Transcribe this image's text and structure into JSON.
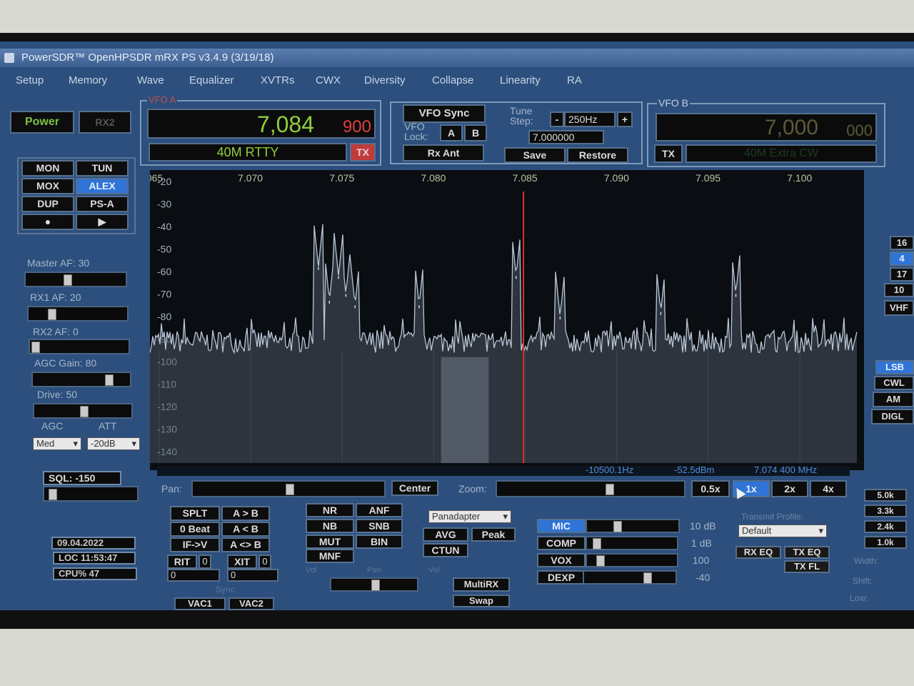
{
  "window": {
    "title": "PowerSDR™ OpenHPSDR mRX PS v3.4.9 (3/19/18)"
  },
  "menu": [
    "Setup",
    "Memory",
    "Wave",
    "Equalizer",
    "XVTRs",
    "CWX",
    "Diversity",
    "Collapse",
    "Linearity",
    "RA"
  ],
  "left": {
    "power": "Power",
    "rx2": "RX2",
    "grid": [
      "MON",
      "TUN",
      "MOX",
      "ALEX",
      "DUP",
      "PS-A",
      "●",
      "▶"
    ],
    "master_af": "Master AF:  30",
    "rx1_af": "RX1 AF:  20",
    "rx2_af": "RX2 AF:  0",
    "agc_gain": "AGC Gain:  80",
    "drive": "Drive:  50",
    "agc_label": "AGC",
    "att_label": "ATT",
    "agc_value": "Med",
    "att_value": "-20dB",
    "sql": "SQL: -150",
    "master_af_level": 0.4,
    "rx1_af_level": 0.2,
    "rx2_af_level": 0.0,
    "agc_gain_level": 0.8,
    "drive_level": 0.5
  },
  "vfo_a": {
    "label": "VFO A",
    "freq_main": "7,084",
    "freq_sub": "900",
    "band": "40M RTTY",
    "tx": "TX"
  },
  "center": {
    "vfo_sync": "VFO Sync",
    "vfo_lock": "VFO Lock:",
    "a": "A",
    "b": "B",
    "tune_step_label": "Tune Step:",
    "minus": "-",
    "step": "250Hz",
    "plus": "+",
    "rx_ant": "Rx Ant",
    "freq_field": "7.000000",
    "save": "Save",
    "restore": "Restore"
  },
  "vfo_b": {
    "label": "VFO B",
    "freq_main": "7,000",
    "freq_sub": "000",
    "tx": "TX",
    "band": "40M Extra CW"
  },
  "spectrum": {
    "freq_labels": [
      {
        "text": "065",
        "mhz": 7.065
      },
      {
        "text": "7.070",
        "mhz": 7.07
      },
      {
        "text": "7.075",
        "mhz": 7.075
      },
      {
        "text": "7.080",
        "mhz": 7.08
      },
      {
        "text": "7.085",
        "mhz": 7.085
      },
      {
        "text": "7.090",
        "mhz": 7.09
      },
      {
        "text": "7.095",
        "mhz": 7.095
      },
      {
        "text": "7.100",
        "mhz": 7.1
      }
    ],
    "db_labels": [
      "-20",
      "-30",
      "-40",
      "-50",
      "-60",
      "-70",
      "-80",
      "-90",
      "-100",
      "-110",
      "-120",
      "-130",
      "-140"
    ],
    "db_range": [
      -145,
      -15
    ],
    "freq_range": [
      7.0645,
      7.1035
    ],
    "vfo_mhz": 7.0849,
    "filter_mhz": [
      7.0804,
      7.083
    ],
    "noise_floor_db": -91,
    "peaks": [
      {
        "mhz": 7.0737,
        "db": -58
      },
      {
        "mhz": 7.0743,
        "db": -73
      },
      {
        "mhz": 7.0748,
        "db": -62
      },
      {
        "mhz": 7.0752,
        "db": -70
      },
      {
        "mhz": 7.0757,
        "db": -75
      },
      {
        "mhz": 7.0792,
        "db": -75
      },
      {
        "mhz": 7.0845,
        "db": -62
      },
      {
        "mhz": 7.0869,
        "db": -80
      },
      {
        "mhz": 7.0924,
        "db": -78
      },
      {
        "mhz": 7.0965,
        "db": -70
      }
    ],
    "readout_offset": "-10500.1Hz",
    "readout_db": "-52.5dBm",
    "readout_freq": "7.074 400 MHz"
  },
  "pan": {
    "label": "Pan:",
    "center": "Center",
    "zoom_label": "Zoom:",
    "zooms": [
      "0.5x",
      "1x",
      "2x",
      "4x"
    ],
    "pan_level": 0.5,
    "zoom_level": 0.6
  },
  "lower_left": {
    "date": "09.04.2022",
    "loc": "LOC 11:53:47",
    "cpu": "CPU%  47",
    "buttons": [
      "SPLT",
      "A > B",
      "0 Beat",
      "A < B",
      "IF->V",
      "A <> B"
    ],
    "rit": "RIT",
    "rit_val": "0",
    "xit": "XIT",
    "xit_val": "0",
    "rit_field": "0",
    "xit_field": "0",
    "sync": "Sync",
    "vac1": "VAC1",
    "vac2": "VAC2"
  },
  "dsp": {
    "buttons": [
      "NR",
      "ANF",
      "NB",
      "SNB",
      "MUT",
      "BIN",
      "MNF"
    ],
    "vol": "Vol",
    "pan": "Pan",
    "vol2": "Vol"
  },
  "display": {
    "mode": "Panadapter",
    "avg": "AVG",
    "peak": "Peak",
    "ctun": "CTUN",
    "multirx": "MultiRX",
    "swap": "Swap"
  },
  "tx": {
    "mic": "MIC",
    "comp": "COMP",
    "vox": "VOX",
    "dexp": "DEXP",
    "mic_val": "10 dB",
    "comp_val": "1 dB",
    "vox_val": "100",
    "dexp_val": "-40",
    "profile_label": "Transmit Profile:",
    "profile": "Default",
    "rx_eq": "RX EQ",
    "tx_eq": "TX EQ",
    "tx_fl": "TX FL",
    "mic_level": 0.3,
    "comp_level": 0.05,
    "vox_level": 0.1,
    "dexp_level": 0.7
  },
  "right": {
    "bands": [
      "16",
      "4",
      "17",
      "10",
      "VHF"
    ],
    "modes": [
      "LSB",
      "CWL",
      "AM",
      "DIGL"
    ],
    "filters": [
      "5.0k",
      "3.3k",
      "2.4k",
      "1.0k"
    ],
    "width": "Width:",
    "shift": "Shift:",
    "low": "Low:"
  },
  "colors": {
    "screen_bg": "#2c4f7d",
    "accent_blue": "#2f74d6",
    "vfo_green": "#8fcf3b",
    "vfo_red": "#e04040",
    "trace": "#b9c6d6"
  }
}
